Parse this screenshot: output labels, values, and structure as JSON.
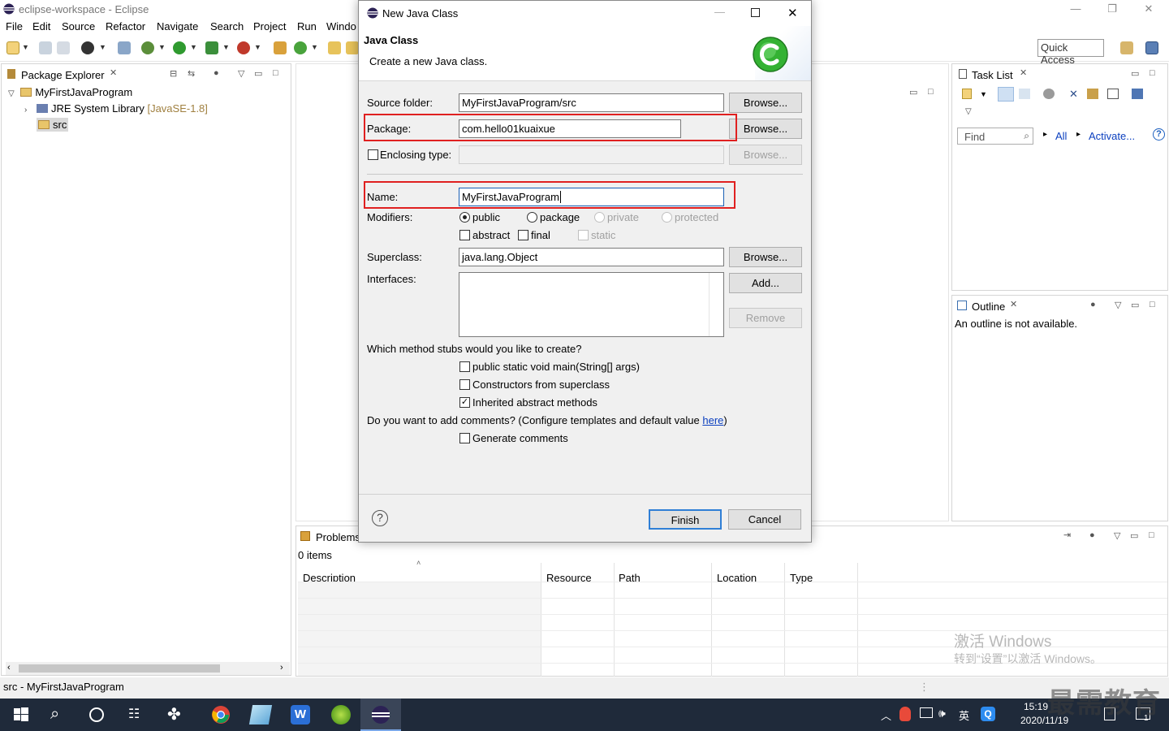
{
  "window": {
    "title": "eclipse-workspace - Eclipse",
    "min": "—",
    "max": "❐",
    "close": "✕"
  },
  "menu": [
    "File",
    "Edit",
    "Source",
    "Refactor",
    "Navigate",
    "Search",
    "Project",
    "Run",
    "Windo"
  ],
  "toolbar": {
    "quick_access_placeholder": "Quick Access"
  },
  "package_explorer": {
    "tab": "Package Explorer",
    "project": "MyFirstJavaProgram",
    "jre": "JRE System Library",
    "jre_version": "[JavaSE-1.8]",
    "src": "src"
  },
  "task_list": {
    "tab": "Task List",
    "find_placeholder": "Find",
    "all": "All",
    "activate": "Activate..."
  },
  "outline": {
    "tab": "Outline",
    "message": "An outline is not available."
  },
  "problems": {
    "tab": "Problems",
    "count": "0 items",
    "columns": [
      "Description",
      "Resource",
      "Path",
      "Location",
      "Type"
    ]
  },
  "status_bar": {
    "text": "src - MyFirstJavaProgram"
  },
  "watermark": {
    "line1": "激活 Windows",
    "line2": "转到“设置”以激活 Windows。",
    "brand": "最需教育"
  },
  "dialog": {
    "title": "New Java Class",
    "header_title": "Java Class",
    "header_desc": "Create a new Java class.",
    "source_folder_label": "Source folder:",
    "source_folder_value": "MyFirstJavaProgram/src",
    "package_label": "Package:",
    "package_value": "com.hello01kuaixue",
    "enclosing_label": "Enclosing type:",
    "name_label": "Name:",
    "name_value": "MyFirstJavaProgram",
    "modifiers_label": "Modifiers:",
    "mod_public": "public",
    "mod_package": "package",
    "mod_private": "private",
    "mod_protected": "protected",
    "mod_abstract": "abstract",
    "mod_final": "final",
    "mod_static": "static",
    "superclass_label": "Superclass:",
    "superclass_value": "java.lang.Object",
    "interfaces_label": "Interfaces:",
    "browse": "Browse...",
    "add": "Add...",
    "remove": "Remove",
    "stubs_question": "Which method stubs would you like to create?",
    "stub_main": "public static void main(String[] args)",
    "stub_constructors": "Constructors from superclass",
    "stub_inherited": "Inherited abstract methods",
    "comments_question_pre": "Do you want to add comments? (Configure templates and default value ",
    "comments_link": "here",
    "comments_question_post": ")",
    "generate_comments": "Generate comments",
    "help": "?",
    "finish": "Finish",
    "cancel": "Cancel"
  },
  "taskbar": {
    "time": "15:19",
    "date": "2020/11/19",
    "ime": "英",
    "notification_count": "1"
  },
  "colors": {
    "red_highlight": "#e02020",
    "link": "#0b3fbf",
    "taskbar": "#1f2a3a"
  }
}
